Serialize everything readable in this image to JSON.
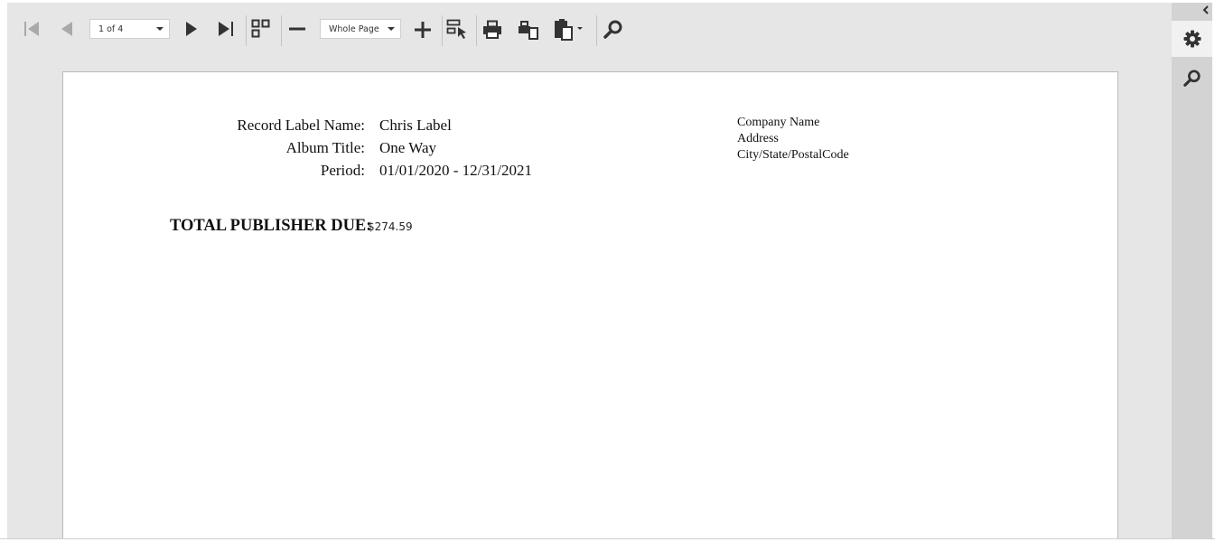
{
  "toolbar": {
    "page_selector": {
      "value": "1 of 4"
    },
    "zoom_selector": {
      "value": "Whole Page"
    }
  },
  "side_panel": {
    "collapse_icon": "chevron-left-icon",
    "tabs": [
      "gear-icon",
      "search-icon"
    ]
  },
  "report": {
    "fields": [
      {
        "label": "Record Label Name:",
        "value": "Chris Label"
      },
      {
        "label": "Album Title:",
        "value": "One Way"
      },
      {
        "label": "Period:",
        "value": "01/01/2020 - 12/31/2021"
      }
    ],
    "company": {
      "name": "Company Name",
      "address": "Address",
      "city_state_zip": "City/State/PostalCode"
    },
    "total_label": "TOTAL PUBLISHER DUE:",
    "total_value": "$274.59"
  },
  "colors": {
    "toolbar_bg": "#e6e6e6",
    "side_panel_bg": "#d3d3d3",
    "icon": "#333333",
    "icon_disabled": "#a9a9a9",
    "page_bg": "#ffffff"
  }
}
